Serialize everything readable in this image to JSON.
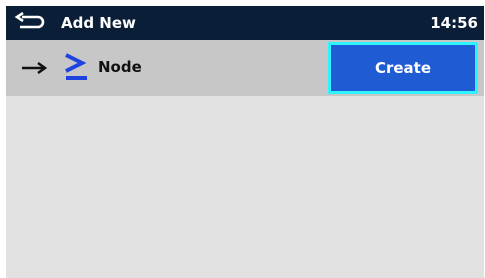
{
  "header": {
    "title": "Add New",
    "time": "14:56",
    "back_icon": "back-return-icon"
  },
  "item": {
    "arrow_icon": "right-arrow-icon",
    "node_icon": "node-chevron-icon",
    "label": "Node"
  },
  "actions": {
    "create_label": "Create"
  },
  "colors": {
    "header_bg": "#0b1e38",
    "row_bg": "#c7c7c7",
    "screen_bg": "#e1e1e1",
    "button_bg": "#1f5bd3",
    "button_border": "#2ff3ff",
    "node_icon": "#1d44e0"
  }
}
